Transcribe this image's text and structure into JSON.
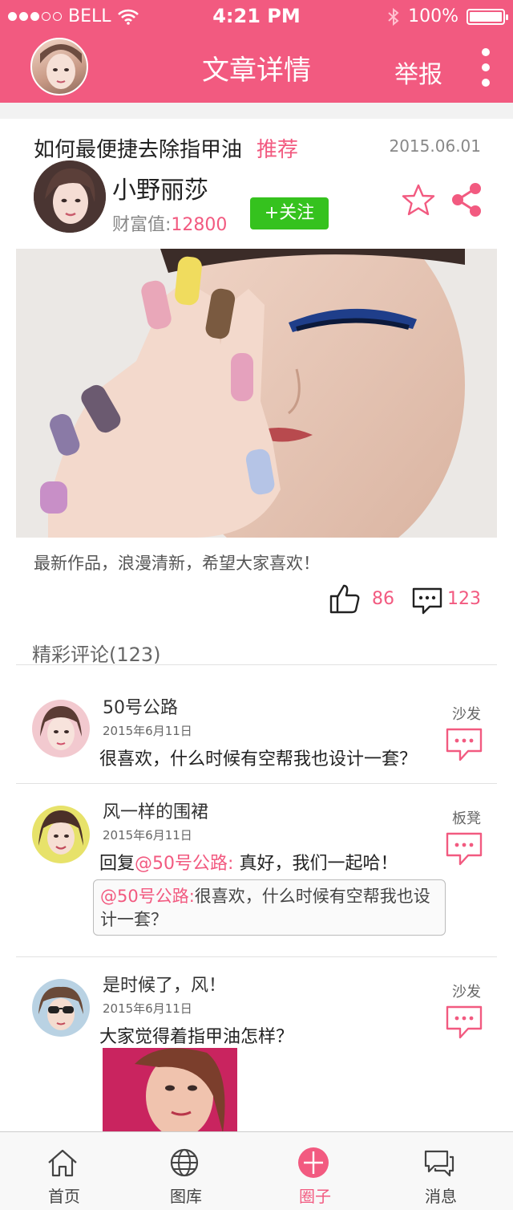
{
  "status_bar": {
    "carrier": "BELL",
    "time": "4:21 PM",
    "battery": "100%",
    "signal_icon": "signal-dots-icon",
    "wifi_icon": "wifi-icon",
    "bluetooth_icon": "bluetooth-icon"
  },
  "nav": {
    "title": "文章详情",
    "report_label": "举报",
    "more_icon": "more-vertical-icon"
  },
  "colors": {
    "accent": "#f25a80",
    "follow": "#35c21e"
  },
  "article": {
    "title": "如何最便捷去除指甲油",
    "tag": "推荐",
    "date": "2015.06.01",
    "author": "小野丽莎",
    "wealth_label": "财富值:",
    "wealth_value": "12800",
    "follow_label": "+关注",
    "description": "最新作品，浪漫清新，希望大家喜欢！",
    "likes": "86",
    "comments": "123"
  },
  "comments_section": {
    "title": "精彩评论(123)",
    "items": [
      {
        "name": "50号公路",
        "date": "2015年6月11日",
        "text": "很喜欢，什么时候有空帮我也设计一套？",
        "floor": "沙发"
      },
      {
        "name": "风一样的围裙",
        "date": "2015年6月11日",
        "reply_prefix": "回复",
        "reply_to": "@50号公路:",
        "text": "真好，我们一起哈！",
        "floor": "板凳",
        "quote_user": "@50号公路:",
        "quote_text": "很喜欢，什么时候有空帮我也设计一套？"
      },
      {
        "name": "是时候了，风！",
        "date": "2015年6月11日",
        "text": "大家觉得着指甲油怎样？",
        "floor": "沙发"
      }
    ]
  },
  "tabbar": {
    "items": [
      {
        "label": "首页",
        "icon": "home-icon"
      },
      {
        "label": "图库",
        "icon": "globe-icon"
      },
      {
        "label": "圈子",
        "icon": "circle-plus-icon",
        "active": true
      },
      {
        "label": "消息",
        "icon": "chat-icon"
      }
    ]
  }
}
